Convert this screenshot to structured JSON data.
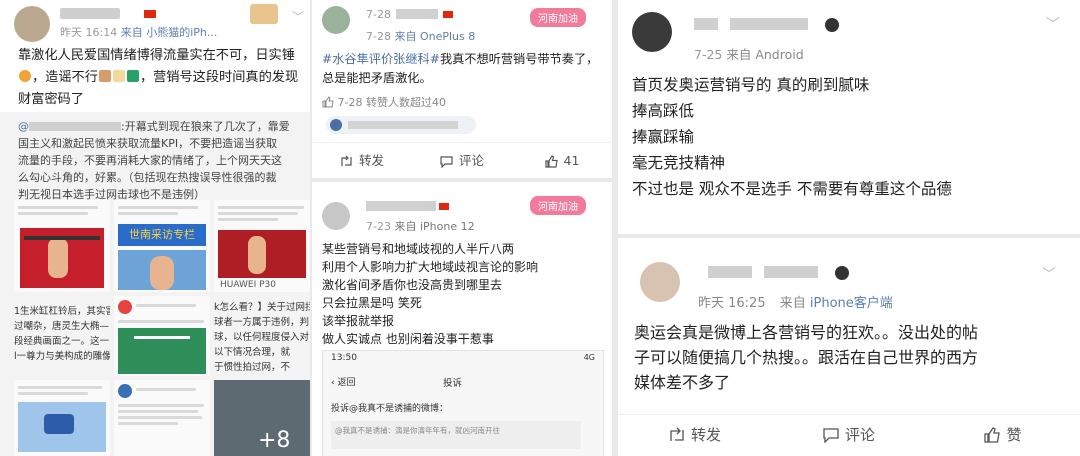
{
  "post1": {
    "time": "昨天 16:14",
    "source": "来自 小熊猫的iPh...",
    "text_line1": "靠激化人民爱国情绪博得流量实在不可，日实锤",
    "text_line2a": "，造谣不行",
    "text_line2b": "，营销号这段时间真的发现",
    "text_line3": "财富密码了",
    "quote_prefix": "@",
    "quote_line1": ":开幕式到现在狼来了几次了，靠爱",
    "quote_line2": "国主义和激起民愤来获取流量KPI，不要把造谣当获取",
    "quote_line3": "流量的手段，不要再消耗大家的情绪了，上个网天天这",
    "quote_line4": "么勾心斗角的，好累。（包括现在热搜误导性很强的裁",
    "quote_line5": "判无视日本选手过网击球也不是违例）",
    "tile_texts": {
      "huawei": "HUAWEI P30",
      "zhinan": "世南采访专栏",
      "snip1": "1生米缸杠铃后，其实害",
      "snip2": "过嘲杂，唐灵生大椭—",
      "snip3": "段经典画面之一。这一",
      "snip4": "l一尊力与美构成的雕像",
      "snip5": "k怎么看？】关于过网拦截",
      "snip6": "球者一方属于违例，判",
      "snip7": "球，以任何程度侵入对",
      "snip8": "以下情况合理，就",
      "snip9": "于惯性拍过网，不",
      "plus": "+8"
    }
  },
  "post2": {
    "time": "7-28",
    "source": "来自 OnePlus 8",
    "badge": "河南加油",
    "hashtag": "#水谷隼评价张继科#",
    "text_rest": "我真不想听营销号带节奏了，",
    "text_line2": "总是能把矛盾激化。",
    "like_note": "7-28 转赞人数超过40",
    "actions": {
      "repost": "转发",
      "comment": "评论",
      "like": "41"
    }
  },
  "post3": {
    "time": "7-23",
    "source": "来自 iPhone 12",
    "badge": "河南加油",
    "lines": [
      "某些营销号和地域歧视的人半斤八两",
      "利用个人影响力扩大地域歧视言论的影响",
      "激化省间矛盾你也没高贵到哪里去",
      "只会拉黑是吗 笑死",
      "该举报就举报",
      "做人实诚点 也别闲着没事干惹事"
    ],
    "phone": {
      "clock": "13:50",
      "back": "返回",
      "title": "投诉",
      "status": "4G",
      "complaint": "投诉@我真不是诱捕的微博：",
      "snippet": "@我真不是诱捕：演是你演年年有，就凶河南开往"
    }
  },
  "post4": {
    "time": "7-25",
    "source": "来自 Android",
    "lines": [
      "首页发奥运营销号的 真的刷到腻味",
      "捧高踩低",
      "捧赢踩输",
      "毫无竞技精神",
      "不过也是 观众不是选手 不需要有尊重这个品德"
    ]
  },
  "post5": {
    "time": "昨天 16:25",
    "source_prefix": "来自",
    "source_name": "iPhone客户端",
    "lines": [
      "奥运会真是微博上各营销号的狂欢。。没出处的帖",
      "子可以随便搞几个热搜。。跟活在自己世界的西方",
      "媒体差不多了"
    ],
    "actions": {
      "repost": "转发",
      "comment": "评论",
      "like": "赞"
    }
  },
  "colors": {
    "link": "#4a6fa5",
    "badge": "#f27a9a",
    "flag": "#de2910"
  },
  "icons": [
    "chevron-down-icon",
    "repost-icon",
    "comment-icon",
    "like-icon",
    "flag-icon",
    "emoji-icon",
    "location-icon"
  ]
}
